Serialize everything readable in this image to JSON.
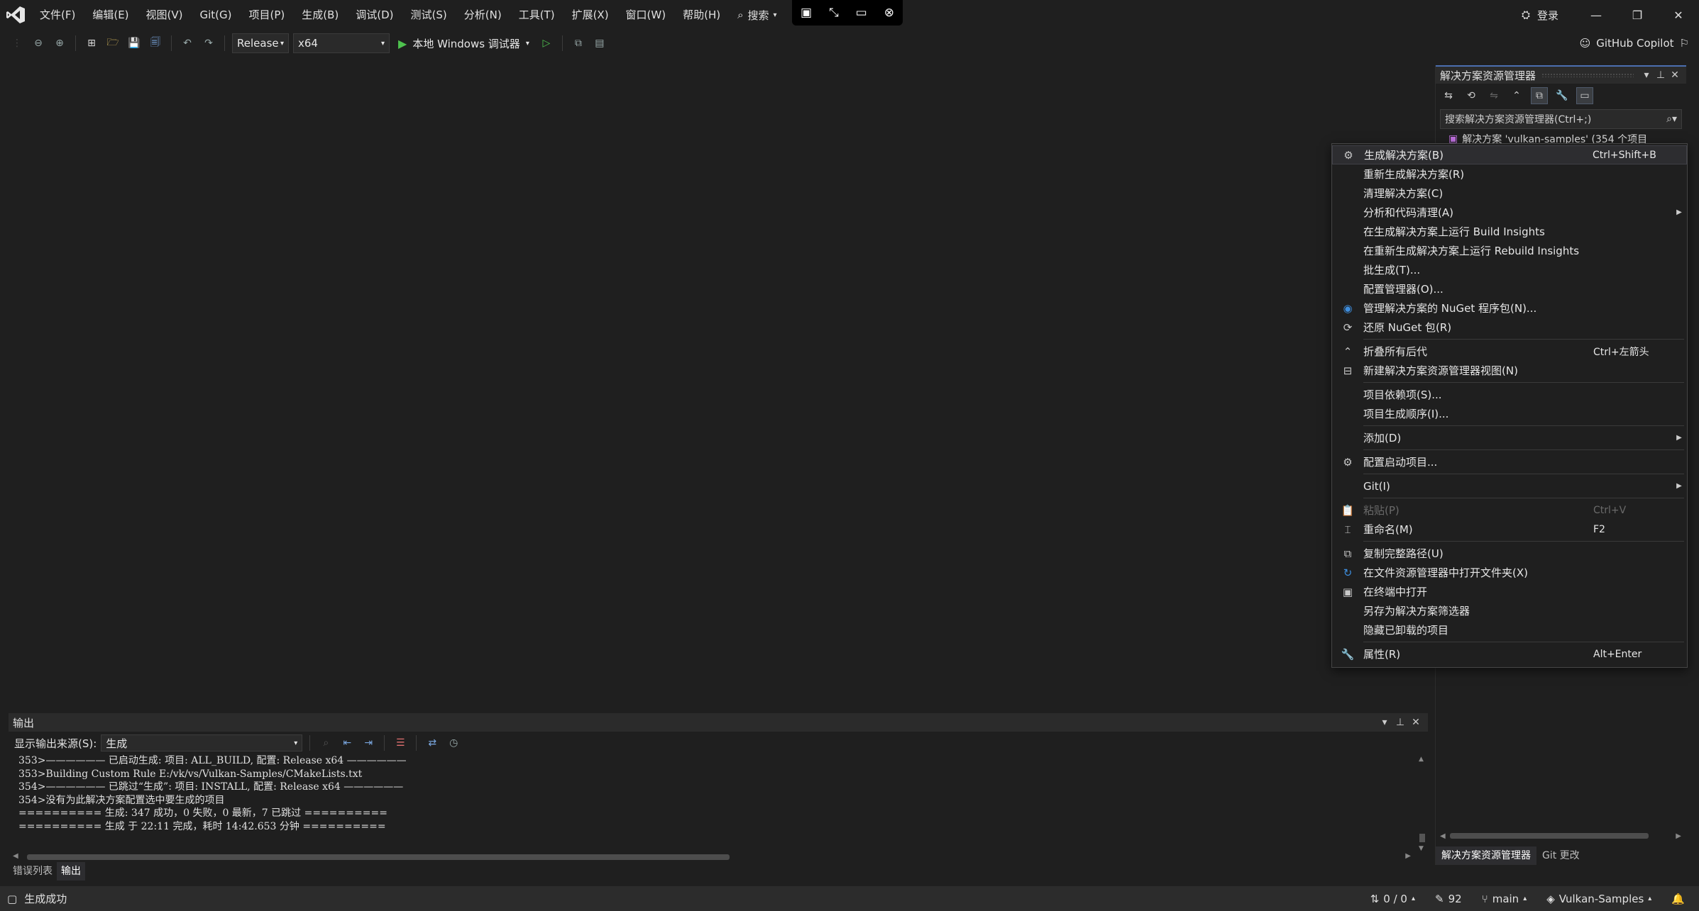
{
  "menu": {
    "items": [
      "文件(F)",
      "编辑(E)",
      "视图(V)",
      "Git(G)",
      "项目(P)",
      "生成(B)",
      "调试(D)",
      "测试(S)",
      "分析(N)",
      "工具(T)",
      "扩展(X)",
      "窗口(W)",
      "帮助(H)"
    ],
    "search_label": "搜索"
  },
  "title_right": {
    "login_label": "登录"
  },
  "toolbar": {
    "config": "Release",
    "platform": "x64",
    "run_label": "本地 Windows 调试器",
    "copilot_label": "GitHub Copilot"
  },
  "solution_explorer": {
    "title": "解决方案资源管理器",
    "search_placeholder": "搜索解决方案资源管理器(Ctrl+;)",
    "tree_row": "解决方案 'vulkan-samples' (354 个项目",
    "tabs": [
      "解决方案资源管理器",
      "Git 更改"
    ]
  },
  "context_menu": {
    "items": [
      {
        "icon": "build-icon",
        "label": "生成解决方案(B)",
        "shortcut": "Ctrl+Shift+B"
      },
      {
        "label": "重新生成解决方案(R)"
      },
      {
        "label": "清理解决方案(C)"
      },
      {
        "label": "分析和代码清理(A)",
        "submenu": true
      },
      {
        "label": "在生成解决方案上运行 Build Insights"
      },
      {
        "label": "在重新生成解决方案上运行 Rebuild Insights"
      },
      {
        "label": "批生成(T)..."
      },
      {
        "label": "配置管理器(O)..."
      },
      {
        "icon": "nuget-icon",
        "label": "管理解决方案的 NuGet 程序包(N)..."
      },
      {
        "icon": "restore-icon",
        "label": "还原 NuGet 包(R)"
      },
      {
        "sep": true
      },
      {
        "icon": "collapse-icon",
        "label": "折叠所有后代",
        "shortcut": "Ctrl+左箭头"
      },
      {
        "icon": "new-view-icon",
        "label": "新建解决方案资源管理器视图(N)"
      },
      {
        "sep": true
      },
      {
        "label": "项目依赖项(S)..."
      },
      {
        "label": "项目生成顺序(I)..."
      },
      {
        "sep": true
      },
      {
        "label": "添加(D)",
        "submenu": true
      },
      {
        "sep": true
      },
      {
        "icon": "gear-icon",
        "label": "配置启动项目..."
      },
      {
        "sep": true
      },
      {
        "label": "Git(I)",
        "submenu": true
      },
      {
        "sep": true
      },
      {
        "icon": "paste-icon",
        "label": "粘贴(P)",
        "shortcut": "Ctrl+V",
        "disabled": true
      },
      {
        "icon": "rename-icon",
        "label": "重命名(M)",
        "shortcut": "F2"
      },
      {
        "sep": true
      },
      {
        "icon": "copy-path-icon",
        "label": "复制完整路径(U)"
      },
      {
        "icon": "open-folder-icon",
        "label": "在文件资源管理器中打开文件夹(X)"
      },
      {
        "icon": "terminal-icon",
        "label": "在终端中打开"
      },
      {
        "label": "另存为解决方案筛选器"
      },
      {
        "label": "隐藏已卸载的项目"
      },
      {
        "sep": true
      },
      {
        "icon": "wrench-icon",
        "label": "属性(R)",
        "shortcut": "Alt+Enter"
      }
    ]
  },
  "output": {
    "title": "输出",
    "source_label": "显示输出来源(S):",
    "source_value": "生成",
    "lines": [
      "353>—————— 已启动生成: 项目: ALL_BUILD, 配置: Release x64 ——————",
      "353>Building Custom Rule E:/vk/vs/Vulkan-Samples/CMakeLists.txt",
      "354>—————— 已跳过“生成”: 项目: INSTALL, 配置: Release x64 ——————",
      "354>没有为此解决方案配置选中要生成的项目",
      "========== 生成: 347 成功，0 失败，0 最新，7 已跳过 ==========",
      "========== 生成 于 22:11 完成，耗时 14:42.653 分钟 =========="
    ]
  },
  "bottom_tabs": [
    "错误列表",
    "输出"
  ],
  "status": {
    "left": "生成成功",
    "lines": "0 / 0",
    "edits": "92",
    "branch": "main",
    "repo": "Vulkan-Samples"
  }
}
